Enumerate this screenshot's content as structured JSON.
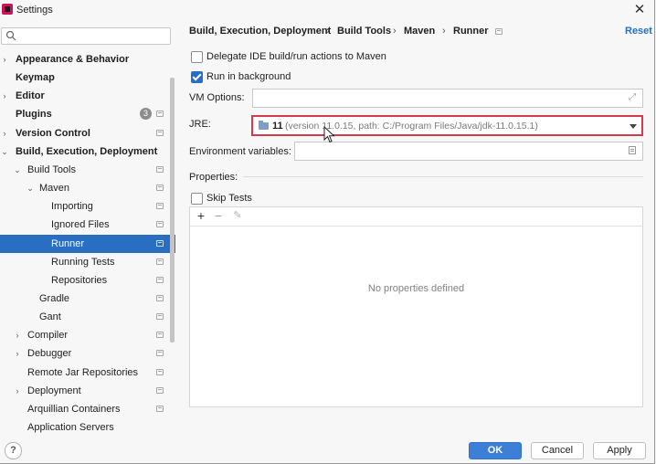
{
  "window": {
    "title": "Settings",
    "close_glyph": "✕"
  },
  "search": {
    "placeholder": "",
    "icon": "search-icon"
  },
  "sidebar": {
    "items": [
      {
        "label": "Appearance & Behavior",
        "arrow": "›",
        "bold": true
      },
      {
        "label": "Keymap",
        "bold": true
      },
      {
        "label": "Editor",
        "arrow": "›",
        "bold": true
      },
      {
        "label": "Plugins",
        "bold": true,
        "badge": "3"
      },
      {
        "label": "Version Control",
        "arrow": "›",
        "bold": true
      },
      {
        "label": "Build, Execution, Deployment",
        "arrow": "⌄",
        "bold": true
      },
      {
        "label": "Build Tools",
        "arrow": "⌄"
      },
      {
        "label": "Maven",
        "arrow": "⌄"
      },
      {
        "label": "Importing"
      },
      {
        "label": "Ignored Files"
      },
      {
        "label": "Runner",
        "selected": true
      },
      {
        "label": "Running Tests"
      },
      {
        "label": "Repositories"
      },
      {
        "label": "Gradle"
      },
      {
        "label": "Gant"
      },
      {
        "label": "Compiler",
        "arrow": "›"
      },
      {
        "label": "Debugger",
        "arrow": "›"
      },
      {
        "label": "Remote Jar Repositories"
      },
      {
        "label": "Deployment",
        "arrow": "›"
      },
      {
        "label": "Arquillian Containers"
      },
      {
        "label": "Application Servers"
      }
    ]
  },
  "breadcrumb": {
    "items": [
      "Build, Execution, Deployment",
      "Build Tools",
      "Maven",
      "Runner"
    ],
    "separator": "›"
  },
  "reset_label": "Reset",
  "form": {
    "delegate_label": "Delegate IDE build/run actions to Maven",
    "delegate_checked": false,
    "background_label": "Run in background",
    "background_checked": true,
    "vm_options_label": "VM Options:",
    "vm_options_value": "",
    "jre_label": "JRE:",
    "jre_version": "11",
    "jre_detail": "(version 11.0.15, path: C:/Program Files/Java/jdk-11.0.15.1)",
    "env_label": "Environment variables:",
    "env_value": "",
    "properties_label": "Properties:",
    "skip_tests_label": "Skip Tests",
    "skip_tests_checked": false,
    "add_glyph": "+",
    "remove_glyph": "−",
    "edit_glyph": "✎",
    "empty_properties": "No properties defined"
  },
  "buttons": {
    "help": "?",
    "ok": "OK",
    "cancel": "Cancel",
    "apply": "Apply"
  },
  "colors": {
    "selection": "#2a6ec2",
    "link": "#2470c2",
    "highlight_border": "#d23b4e",
    "ok_button": "#3d7fd6"
  }
}
